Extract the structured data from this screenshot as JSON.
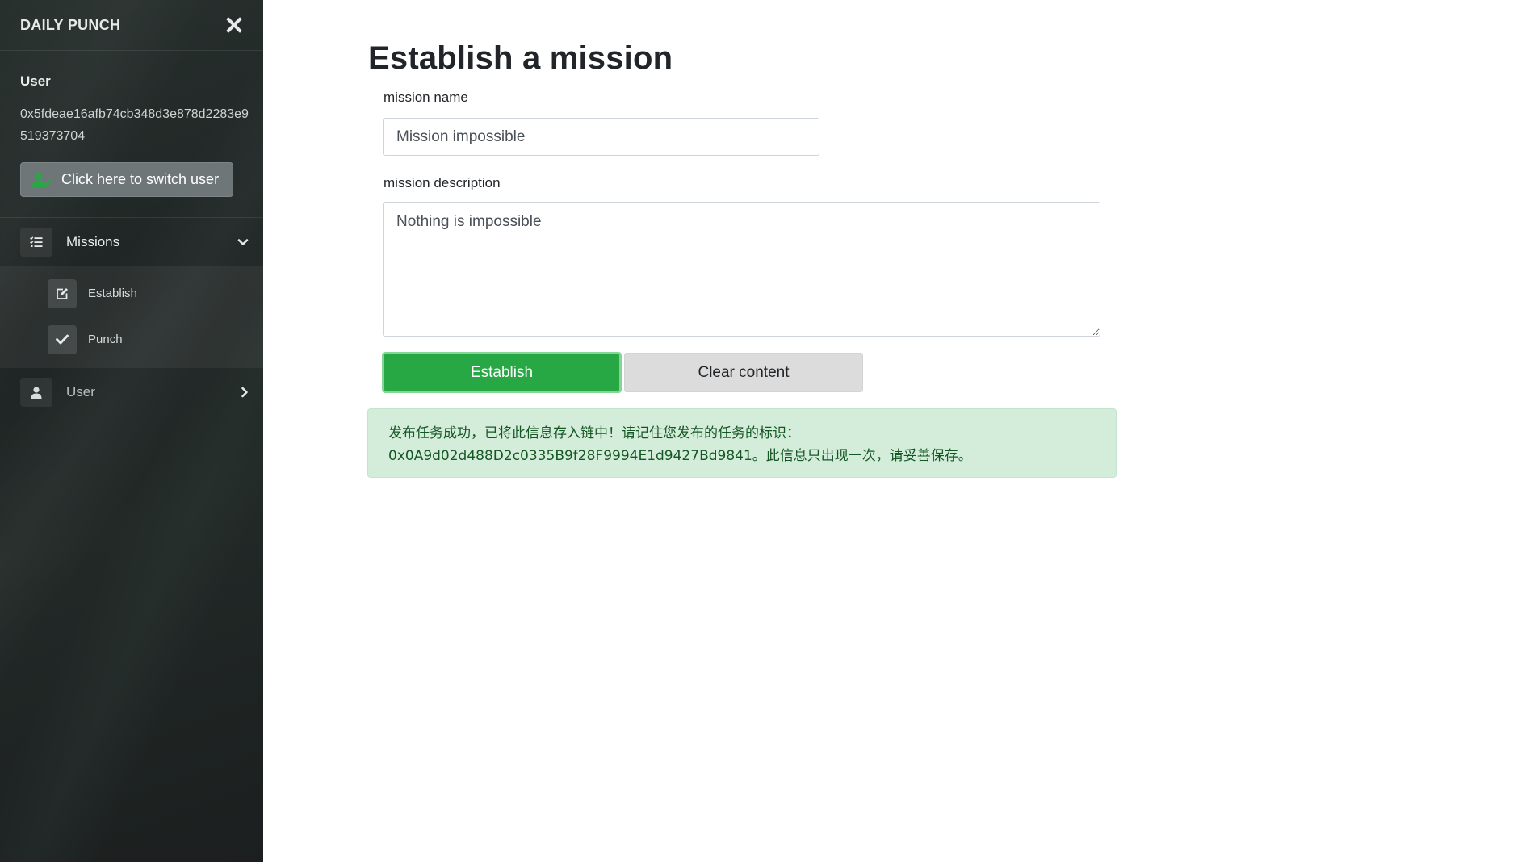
{
  "sidebar": {
    "brand": "DAILY PUNCH",
    "user_label": "User",
    "user_address": "0x5fdeae16afb74cb348d3e878d2283e9519373704",
    "switch_user_label": "Click here to switch user",
    "nav": {
      "missions_label": "Missions",
      "sub_items": [
        {
          "label": "Establish",
          "icon": "edit-icon"
        },
        {
          "label": "Punch",
          "icon": "check-icon"
        }
      ],
      "user_label": "User"
    },
    "colors": {
      "switch_icon": "#28a745"
    }
  },
  "main": {
    "title": "Establish a mission",
    "name_label": "mission name",
    "name_value": "Mission impossible",
    "description_label": "mission description",
    "description_value": "Nothing is impossible",
    "establish_label": "Establish",
    "clear_label": "Clear content",
    "alert": {
      "line1": "发布任务成功，已将此信息存入链中！请记住您发布的任务的标识：",
      "line2": "0x0A9d02d488D2c0335B9f28F9994E1d9427Bd9841。此信息只出现一次，请妥善保存。"
    }
  }
}
